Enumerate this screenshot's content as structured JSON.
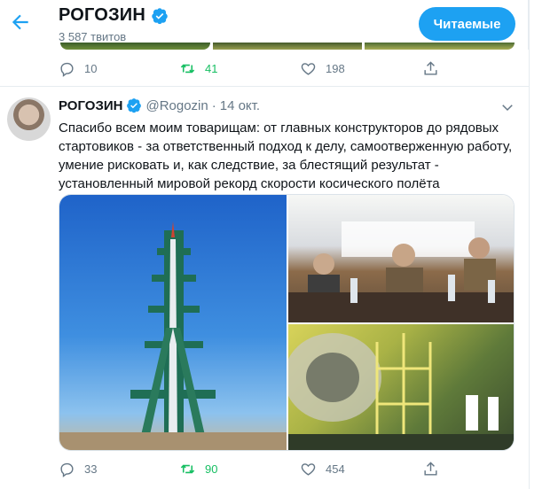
{
  "header": {
    "title": "РОГОЗИН",
    "tweet_count": "3 587 твитов",
    "follow_label": "Читаемые"
  },
  "prev_tweet": {
    "replies": "10",
    "retweets": "41",
    "likes": "198"
  },
  "tweet": {
    "name": "РОГОЗИН",
    "handle": "@Rogozin",
    "dot": "·",
    "date": "14 окт.",
    "text": "Спасибо всем моим товарищам: от главных конструкторов до рядовых стартовиков - за ответственный подход к делу, самоотверженную работу, умение рисковать и, как следствие, за блестящий результат  - установленный мировой рекорд скорости косического полёта",
    "replies": "33",
    "retweets": "90",
    "likes": "454"
  },
  "colors": {
    "accent": "#1da1f2",
    "retweet": "#17bf63",
    "muted": "#657786"
  }
}
